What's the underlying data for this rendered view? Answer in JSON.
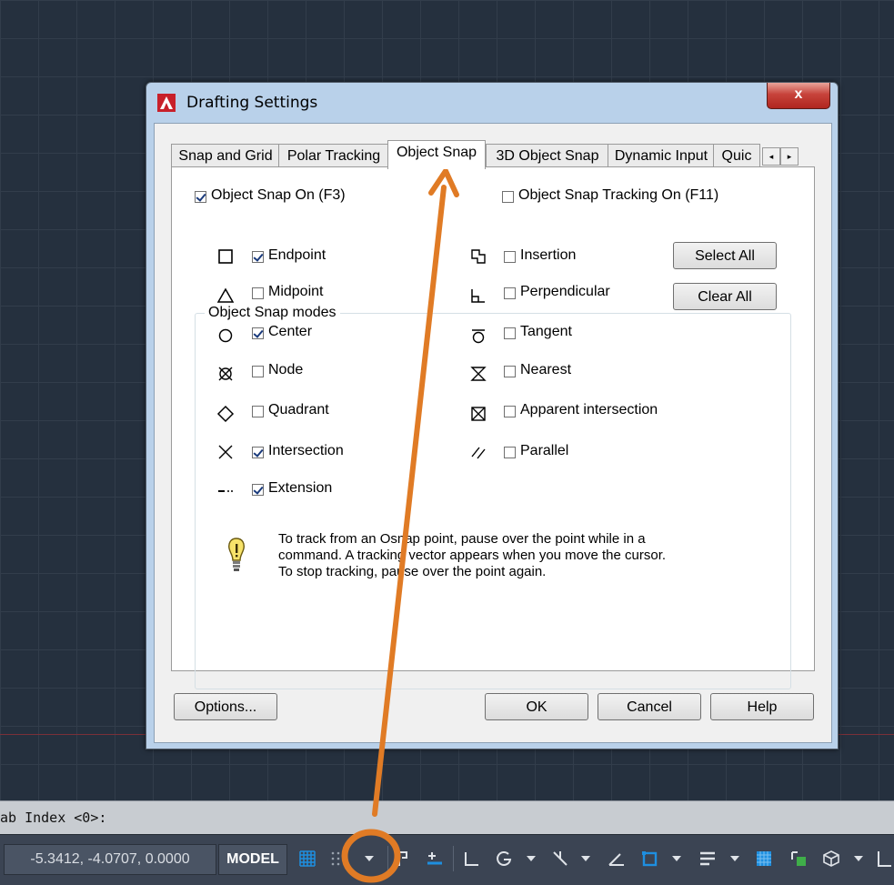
{
  "dialog": {
    "title": "Drafting Settings",
    "close_label": "x",
    "tabs": [
      {
        "label": "Snap and Grid"
      },
      {
        "label": "Polar Tracking"
      },
      {
        "label": "Object Snap"
      },
      {
        "label": "3D Object Snap"
      },
      {
        "label": "Dynamic Input"
      },
      {
        "label": "Quic"
      }
    ],
    "osnap_on": {
      "label": "Object Snap On (F3)",
      "checked": true
    },
    "tracking_on": {
      "label": "Object Snap Tracking On (F11)",
      "checked": false
    },
    "modes_group_title": "Object Snap modes",
    "left_modes": [
      {
        "label": "Endpoint",
        "checked": true,
        "icon": "square-icon"
      },
      {
        "label": "Midpoint",
        "checked": false,
        "icon": "triangle-icon"
      },
      {
        "label": "Center",
        "checked": true,
        "icon": "circle-icon"
      },
      {
        "label": "Node",
        "checked": false,
        "icon": "node-icon"
      },
      {
        "label": "Quadrant",
        "checked": false,
        "icon": "diamond-icon"
      },
      {
        "label": "Intersection",
        "checked": true,
        "icon": "x-icon"
      },
      {
        "label": "Extension",
        "checked": true,
        "icon": "extension-icon"
      }
    ],
    "right_modes": [
      {
        "label": "Insertion",
        "checked": false,
        "icon": "insertion-icon"
      },
      {
        "label": "Perpendicular",
        "checked": false,
        "icon": "perpendicular-icon"
      },
      {
        "label": "Tangent",
        "checked": false,
        "icon": "tangent-icon"
      },
      {
        "label": "Nearest",
        "checked": false,
        "icon": "hourglass-icon"
      },
      {
        "label": "Apparent intersection",
        "checked": false,
        "icon": "boxed-x-icon"
      },
      {
        "label": "Parallel",
        "checked": false,
        "icon": "parallel-icon"
      }
    ],
    "select_all_label": "Select All",
    "clear_all_label": "Clear All",
    "hint_lines": [
      "To track from an Osnap point, pause over the point while in a",
      "command.  A tracking vector appears when you move the cursor.",
      "To stop tracking, pause over the point again."
    ],
    "options_label": "Options...",
    "ok_label": "OK",
    "cancel_label": "Cancel",
    "help_label": "Help"
  },
  "command_line": "ab Index <0>:",
  "status_bar": {
    "coordinates": "-5.3412, -4.0707, 0.0000",
    "model_label": "MODEL"
  },
  "colors": {
    "annotation": "#e07b25",
    "accent_blue": "#1e8fe0"
  }
}
